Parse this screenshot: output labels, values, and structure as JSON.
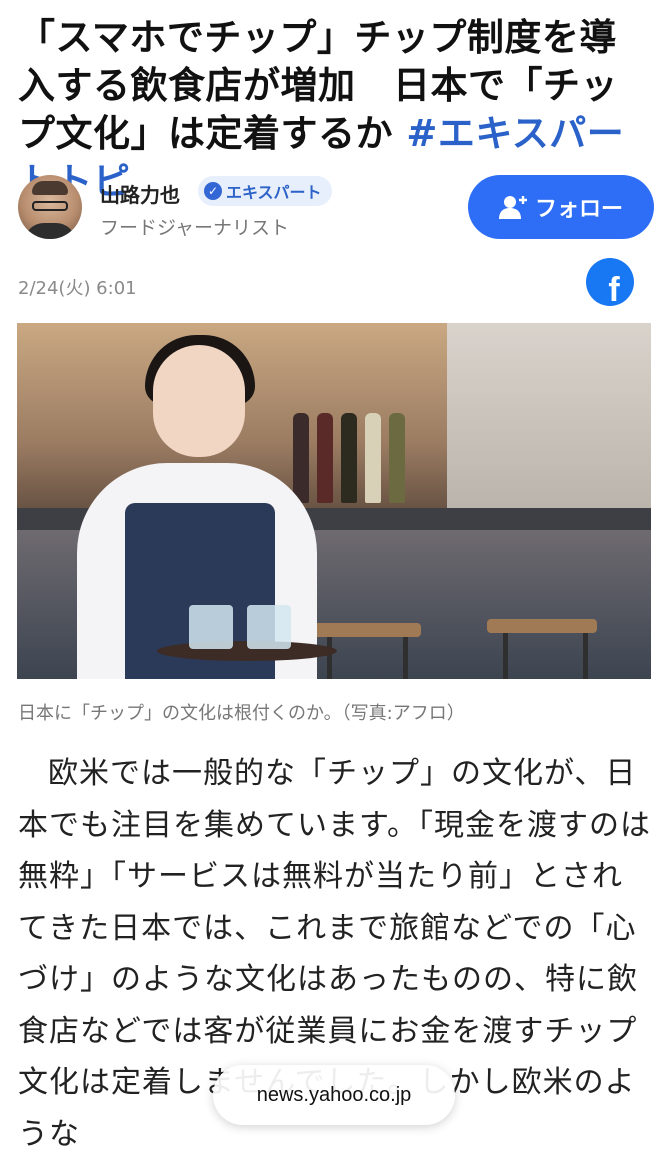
{
  "article": {
    "title": "「スマホでチップ」チップ制度を導入する飲食店が増加　日本で「チップ文化」は定着するか",
    "hashtag": "#エキスパートトピ",
    "date": "2/24(火) 6:01",
    "image_caption": "日本に「チップ」の文化は根付くのか。（写真:アフロ）",
    "body": "欧米では一般的な「チップ」の文化が、日本でも注目を集めています。「現金を渡すのは無粋」「サービスは無料が当たり前」とされてきた日本では、これまで旅館などでの「心づけ」のような文化はあったものの、特に飲食店などでは客が従業員にお金を渡すチップ文化は定着しませんでした。しかし欧米のような"
  },
  "author": {
    "name": "山路力也",
    "badge": "エキスパート",
    "role": "フードジャーナリスト",
    "follow_label": "フォロー"
  },
  "share": {
    "facebook_glyph": "f"
  },
  "browser": {
    "domain": "news.yahoo.co.jp"
  },
  "colors": {
    "accent": "#2e6ef6",
    "hashtag": "#2a62c9",
    "facebook": "#1877f2"
  }
}
